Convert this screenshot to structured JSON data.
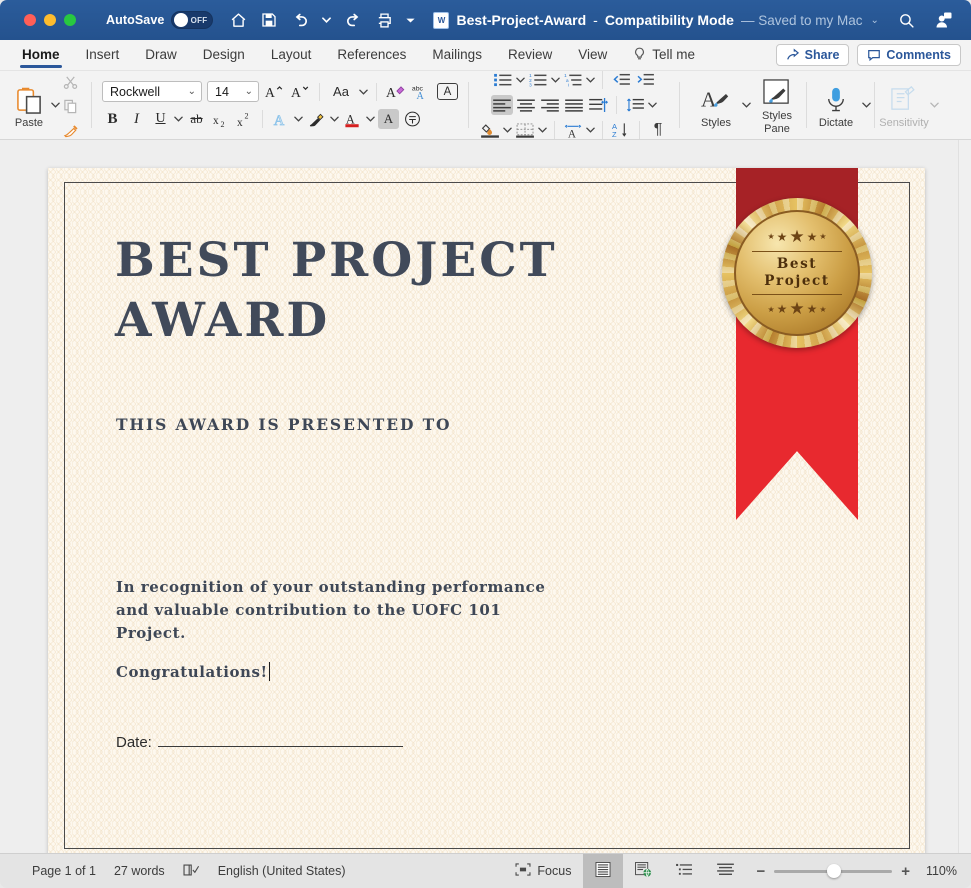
{
  "titlebar": {
    "autosave_label": "AutoSave",
    "autosave_state": "OFF",
    "doc_title": "Best-Project-Award",
    "separator": "-",
    "mode": "Compatibility Mode",
    "saved_status": "— Saved to my Mac",
    "word_icon": "word-app-icon",
    "quick_access": [
      {
        "name": "home-icon",
        "label": "Home"
      },
      {
        "name": "save-icon",
        "label": "Save"
      },
      {
        "name": "undo-icon",
        "label": "Undo"
      },
      {
        "name": "undo-dropdown-caret",
        "label": "⌄"
      },
      {
        "name": "redo-icon",
        "label": "Redo"
      },
      {
        "name": "print-icon",
        "label": "Print"
      },
      {
        "name": "customize-toolbar-caret",
        "label": "⌄"
      }
    ],
    "search_icon": "search-icon",
    "account_icon": "account-avatar-icon"
  },
  "tabs": [
    {
      "label": "Home",
      "active": true
    },
    {
      "label": "Insert",
      "active": false
    },
    {
      "label": "Draw",
      "active": false
    },
    {
      "label": "Design",
      "active": false
    },
    {
      "label": "Layout",
      "active": false
    },
    {
      "label": "References",
      "active": false
    },
    {
      "label": "Mailings",
      "active": false
    },
    {
      "label": "Review",
      "active": false
    },
    {
      "label": "View",
      "active": false
    },
    {
      "label": "Tell me",
      "active": false
    }
  ],
  "tabbar_right": {
    "share_label": "Share",
    "comments_label": "Comments"
  },
  "ribbon": {
    "clipboard": {
      "paste_label": "Paste",
      "cut_icon": "scissors-icon",
      "copy_icon": "copy-icon",
      "format_painter_icon": "format-painter-icon"
    },
    "font": {
      "font_name": "Rockwell",
      "font_size": "14",
      "grow_font_icon": "grow-font-icon",
      "shrink_font_icon": "shrink-font-icon",
      "change_case_label": "Aa",
      "clear_formatting_icon": "clear-formatting-icon",
      "spelling_icon": "abc-spelling-icon",
      "text_box_icon": "character-border-icon",
      "bold_label": "B",
      "italic_label": "I",
      "underline_label": "U",
      "strikethrough_label": "ab",
      "subscript_label": "x",
      "superscript_label": "x",
      "text_effects_icon": "text-effects-icon",
      "highlight_icon": "highlight-color-icon",
      "font_color_icon": "font-color-icon",
      "shading_icon": "text-shading-icon",
      "phonetic_icon": "phonetic-guide-icon"
    },
    "paragraph": {
      "bullets_icon": "bullet-list-icon",
      "numbering_icon": "numbered-list-icon",
      "multilevel_icon": "multilevel-list-icon",
      "decrease_indent_icon": "decrease-indent-icon",
      "increase_indent_icon": "increase-indent-icon",
      "align_left_icon": "align-left-icon",
      "align_center_icon": "align-center-icon",
      "align_right_icon": "align-right-icon",
      "justify_icon": "justify-icon",
      "distributed_icon": "distributed-text-icon",
      "line_spacing_icon": "line-spacing-icon",
      "shading_icon": "paragraph-shading-icon",
      "borders_icon": "borders-icon",
      "text_direction_icon": "text-direction-icon",
      "sort_icon": "sort-az-icon",
      "show_marks_icon": "show-formatting-marks-icon"
    },
    "styles": {
      "styles_label": "Styles",
      "styles_pane_label": "Styles Pane",
      "dictate_label": "Dictate",
      "sensitivity_label": "Sensitivity"
    }
  },
  "document": {
    "title_line1": "BEST PROJECT",
    "title_line2": "AWARD",
    "presented_to": "THIS AWARD IS PRESENTED TO",
    "body_paragraph": "In recognition of your outstanding performance and valuable contribution to the UOFC 101 Project.",
    "congratulations": "Congratulations!",
    "date_label": "Date:",
    "badge": {
      "line1": "Best",
      "line2": "Project",
      "star_glyph": "★",
      "gold_color": "#d9a84e",
      "ribbon_color": "#e8292f",
      "ribbon_dark_color": "#a62226"
    },
    "colors": {
      "paper": "#fdf8ef",
      "text": "#3e4756"
    }
  },
  "statusbar": {
    "page_label": "Page 1 of 1",
    "word_count": "27 words",
    "proofing_icon": "proofing-check-icon",
    "language": "English (United States)",
    "focus_label": "Focus",
    "focus_icon": "focus-mode-icon",
    "view_print_icon": "print-layout-view-icon",
    "view_web_icon": "web-layout-view-icon",
    "view_outline_icon": "outline-view-icon",
    "view_draft_icon": "draft-view-icon",
    "zoom_out_label": "−",
    "zoom_in_label": "+",
    "zoom_level": "110%"
  }
}
